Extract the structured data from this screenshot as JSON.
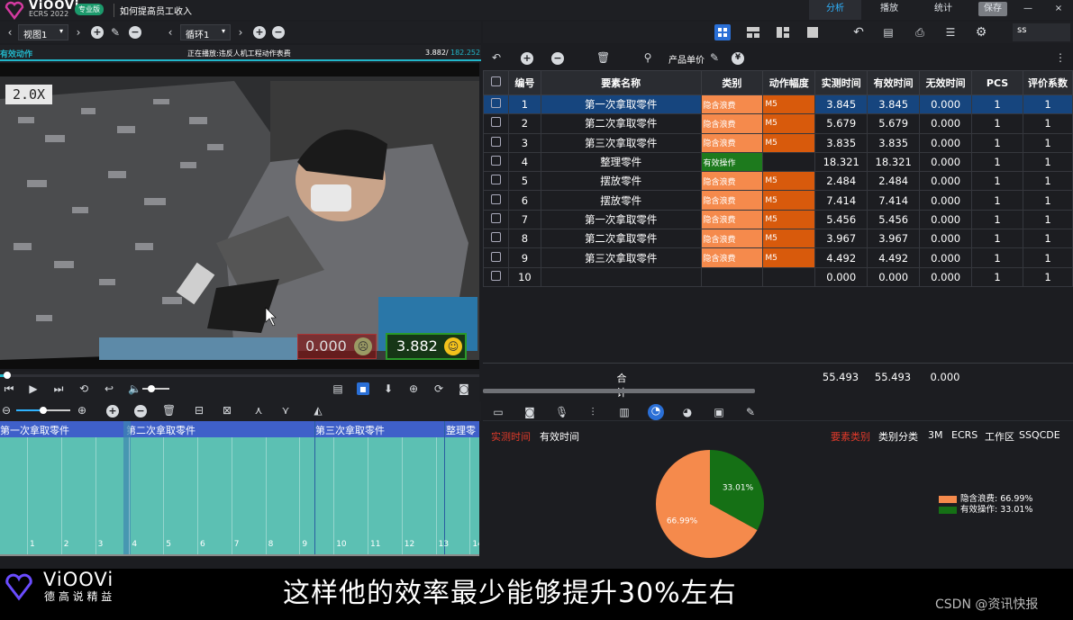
{
  "app": {
    "logo_name": "ViOOVi",
    "logo_version": "ECRS 2022",
    "edition_badge": "专业版",
    "doc_title": "如何提高员工收入"
  },
  "topnav": {
    "tabs": [
      "分析",
      "播放",
      "统计"
    ],
    "active_tab": "分析",
    "save_label": "保存",
    "min_label": "—",
    "close_label": "×"
  },
  "toolbar": {
    "view_select": "视图1",
    "loop_select": "循环1",
    "search_value": "ss",
    "product_price_label": "产品单价"
  },
  "video_panel": {
    "title_left": "有效动作",
    "title_center": "正在播放:违反人机工程动作表费",
    "time_current": "3.882/",
    "time_total": "182.252",
    "speed": "2.0X",
    "counter_invalid": "0.000",
    "counter_valid": "3.882"
  },
  "table": {
    "columns": [
      "编号",
      "要素名称",
      "类别",
      "动作幅度",
      "实测时间",
      "有效时间",
      "无效时间",
      "PCS",
      "评价系数"
    ],
    "rows": [
      {
        "id": "1",
        "name": "第一次拿取零件",
        "cat": "隐含浪费",
        "amp": "M5",
        "measured": "3.845",
        "effective": "3.845",
        "invalid": "0.000",
        "pcs": "1",
        "coef": "1"
      },
      {
        "id": "2",
        "name": "第二次拿取零件",
        "cat": "隐含浪费",
        "amp": "M5",
        "measured": "5.679",
        "effective": "5.679",
        "invalid": "0.000",
        "pcs": "1",
        "coef": "1"
      },
      {
        "id": "3",
        "name": "第三次拿取零件",
        "cat": "隐含浪费",
        "amp": "M5",
        "measured": "3.835",
        "effective": "3.835",
        "invalid": "0.000",
        "pcs": "1",
        "coef": "1"
      },
      {
        "id": "4",
        "name": "整理零件",
        "cat": "有效操作",
        "amp": "",
        "measured": "18.321",
        "effective": "18.321",
        "invalid": "0.000",
        "pcs": "1",
        "coef": "1"
      },
      {
        "id": "5",
        "name": "摆放零件",
        "cat": "隐含浪费",
        "amp": "M5",
        "measured": "2.484",
        "effective": "2.484",
        "invalid": "0.000",
        "pcs": "1",
        "coef": "1"
      },
      {
        "id": "6",
        "name": "摆放零件",
        "cat": "隐含浪费",
        "amp": "M5",
        "measured": "7.414",
        "effective": "7.414",
        "invalid": "0.000",
        "pcs": "1",
        "coef": "1"
      },
      {
        "id": "7",
        "name": "第一次拿取零件",
        "cat": "隐含浪费",
        "amp": "M5",
        "measured": "5.456",
        "effective": "5.456",
        "invalid": "0.000",
        "pcs": "1",
        "coef": "1"
      },
      {
        "id": "8",
        "name": "第二次拿取零件",
        "cat": "隐含浪费",
        "amp": "M5",
        "measured": "3.967",
        "effective": "3.967",
        "invalid": "0.000",
        "pcs": "1",
        "coef": "1"
      },
      {
        "id": "9",
        "name": "第三次拿取零件",
        "cat": "隐含浪费",
        "amp": "M5",
        "measured": "4.492",
        "effective": "4.492",
        "invalid": "0.000",
        "pcs": "1",
        "coef": "1"
      },
      {
        "id": "10",
        "name": "",
        "cat": "",
        "amp": "",
        "measured": "0.000",
        "effective": "0.000",
        "invalid": "0.000",
        "pcs": "1",
        "coef": "1"
      }
    ],
    "total_label": "合计",
    "total_measured": "55.493",
    "total_effective": "55.493",
    "total_invalid": "0.000"
  },
  "timeline": {
    "labels": [
      "第一次拿取零件",
      "第二次拿取零件",
      "第三次拿取零件",
      "整理零"
    ],
    "ticks": [
      "1",
      "2",
      "3",
      "4",
      "5",
      "6",
      "7",
      "8",
      "9",
      "10",
      "11",
      "12",
      "13",
      "14"
    ]
  },
  "chart_panel": {
    "left_tabs": [
      "实测时间",
      "有效时间"
    ],
    "active_left": "实测时间",
    "right_tabs": [
      "要素类别",
      "类别分类",
      "3M",
      "ECRS",
      "工作区",
      "SSQCDE"
    ],
    "active_right": "要素类别"
  },
  "chart_data": {
    "type": "pie",
    "slices": [
      {
        "label": "隐含浪费",
        "value": 66.99,
        "text": "66.99%",
        "legend": "隐含浪费: 66.99%",
        "color": "#f58a4c"
      },
      {
        "label": "有效操作",
        "value": 33.01,
        "text": "33.01%",
        "legend": "有效操作: 33.01%",
        "color": "#157015"
      }
    ]
  },
  "subtitle": {
    "logo_name": "ViOOVi",
    "slogan": "德 高 说 精 益",
    "text": "这样他的效率最少能够提升30%左右",
    "watermark": "CSDN @资讯快报"
  },
  "colors": {
    "accent": "#21b6c9",
    "waste": "#f58a4c",
    "effective": "#1d7a1d",
    "selected_row": "#16457e",
    "timeline": "#5cc0b3",
    "timeline_header": "#3f60c9"
  }
}
